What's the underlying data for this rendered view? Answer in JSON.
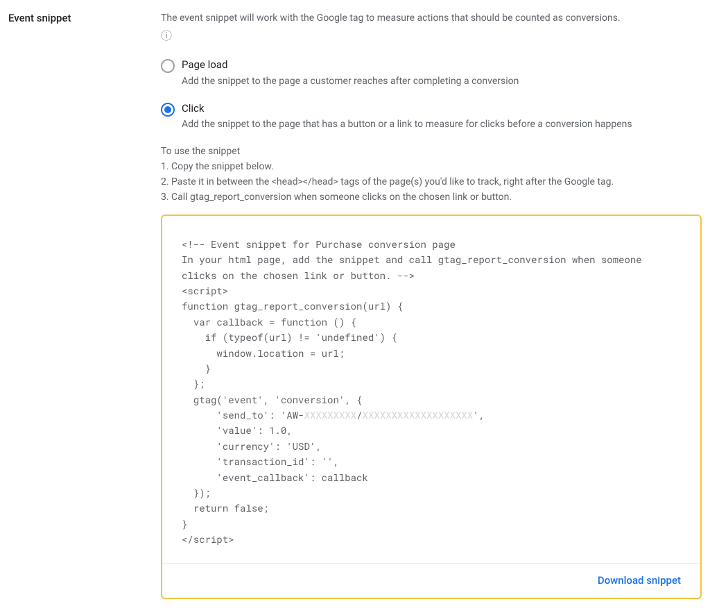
{
  "section": {
    "title": "Event snippet"
  },
  "intro": "The event snippet will work with the Google tag to measure actions that should be counted as conversions.",
  "radios": {
    "page_load": {
      "label": "Page load",
      "desc": "Add the snippet to the page a customer reaches after completing a conversion"
    },
    "click": {
      "label": "Click",
      "desc": "Add the snippet to the page that has a button or a link to measure for clicks before a conversion happens"
    }
  },
  "steps": {
    "heading": "To use the snippet",
    "s1": "1. Copy the snippet below.",
    "s2": "2. Paste it in between the <head></head> tags of the page(s) you'd like to track, right after the Google tag.",
    "s3": "3. Call gtag_report_conversion when someone clicks on the chosen link or button."
  },
  "code": {
    "l1": "<!-- Event snippet for Purchase conversion page",
    "l2": "In your html page, add the snippet and call gtag_report_conversion when someone clicks on the chosen link or button. -->",
    "l3": "<script>",
    "l4": "function gtag_report_conversion(url) {",
    "l5": "  var callback = function () {",
    "l6": "    if (typeof(url) != 'undefined') {",
    "l7": "      window.location = url;",
    "l8": "    }",
    "l9": "  };",
    "l10": "  gtag('event', 'conversion', {",
    "l11a": "      'send_to': 'AW-",
    "l11b": "XXXXXXXXX",
    "l11c": "/",
    "l11d": "XXXXXXXXXXXXXXXXXXX",
    "l11e": "',",
    "l12": "      'value': 1.0,",
    "l13": "      'currency': 'USD',",
    "l14": "      'transaction_id': '',",
    "l15": "      'event_callback': callback",
    "l16": "  });",
    "l17": "  return false;",
    "l18": "}",
    "l19": "</scr"
  },
  "download": {
    "label": "Download snippet"
  }
}
